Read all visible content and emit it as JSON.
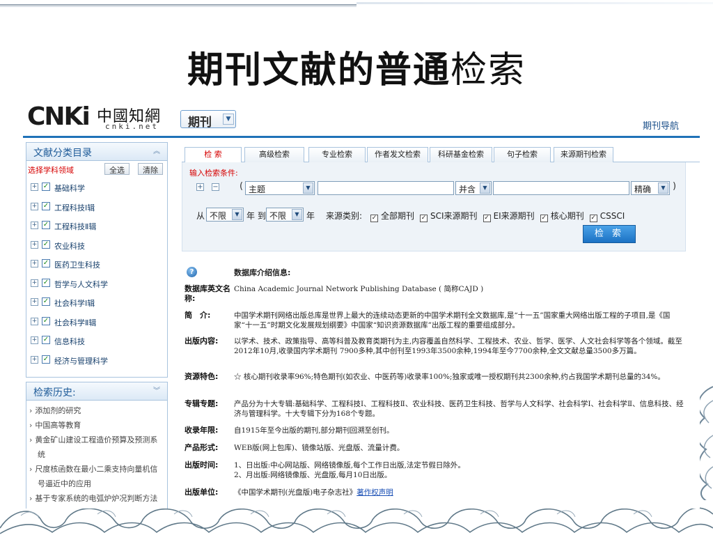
{
  "slide": {
    "title_bold": "期刊文献的普通",
    "title_normal": "检索"
  },
  "header": {
    "logo_cnki": "CNKi",
    "logo_cn": "中國知網",
    "logo_net": "cnki.net",
    "type_select": "期刊",
    "nav_link": "期刊导航"
  },
  "sidebar": {
    "title": "文献分类目录",
    "subject_label": "选择学科领域",
    "select_all": "全选",
    "clear": "清除",
    "items": [
      "基础科学",
      "工程科技Ⅰ辑",
      "工程科技Ⅱ辑",
      "农业科技",
      "医药卫生科技",
      "哲学与人文科学",
      "社会科学Ⅰ辑",
      "社会科学Ⅱ辑",
      "信息科技",
      "经济与管理科学"
    ]
  },
  "history": {
    "title": "检索历史:",
    "items": [
      [
        "添加剂的研究"
      ],
      [
        "中国高等教育"
      ],
      [
        "黄金矿山建设工程造价预算及预测系",
        "统"
      ],
      [
        "尺度核函数在最小二乘支持向量机信",
        "号逼近中的应用"
      ],
      [
        "基于专家系统的电弧炉炉况判断方法"
      ]
    ]
  },
  "tabs": [
    "检 索",
    "高级检索",
    "专业检索",
    "作者发文检索",
    "科研基金检索",
    "句子检索",
    "来源期刊检索"
  ],
  "search": {
    "condition_label": "输入检索条件:",
    "plus": "+",
    "minus": "−",
    "paren_open": "(",
    "paren_close": ")",
    "field": "主题",
    "term1": "",
    "relation": "并含",
    "term2": "",
    "match": "精确",
    "from_label": "从",
    "from_year": "不限",
    "year_to": "年 到",
    "to_year": "不限",
    "year": "年",
    "source_label": "来源类别:",
    "sources": [
      "全部期刊",
      "SCI来源期刊",
      "EI来源期刊",
      "核心期刊",
      "CSSCI"
    ],
    "search_button": "检 索"
  },
  "info": {
    "title": "数据库介绍信息:",
    "rows": [
      {
        "k": "数据库英文名称:",
        "v": "China Academic Journal Network Publishing Database ( 简称CAJD )"
      },
      {
        "k": "简　介:",
        "v": "中国学术期刊网络出版总库是世界上最大的连续动态更新的中国学术期刊全文数据库,是“十一五”国家重大网络出版工程的子项目,是《国家“十一五”时期文化发展规划纲要》中国家“知识资源数据库”出版工程的重要组成部分。"
      },
      {
        "k": "出版内容:",
        "v": "以学术、技术、政策指导、高等科普及教育类期刊为主,内容覆盖自然科学、工程技术、农业、哲学、医学、人文社会科学等各个领域。截至2012年10月,收录国内学术期刊 7900多种,其中创刊至1993年3500余种,1994年至今7700余种,全文文献总量3500多万篇。"
      },
      {
        "k": "资源特色:",
        "v": "☆ 核心期刊收录率96%;特色期刊(如农业、中医药等)收录率100%;独家或唯一授权期刊共2300余种,约占我国学术期刊总量的34%。"
      },
      {
        "k": "专辑专题:",
        "v": "产品分为十大专辑:基础科学、工程科技Ⅰ、工程科技Ⅱ、农业科技、医药卫生科技、哲学与人文科学、社会科学Ⅰ、社会科学Ⅱ、信息科技、经济与管理科学。十大专辑下分为168个专题。"
      },
      {
        "k": "收录年限:",
        "v": "自1915年至今出版的期刊,部分期刊回溯至创刊。"
      },
      {
        "k": "产品形式:",
        "v": "WEB版(网上包库)、镜像站版、光盘版、流量计费。"
      },
      {
        "k": "出版时间:",
        "v1": "1、日出版:中心网站版、网络镜像版,每个工作日出版,法定节假日除外。",
        "v2": "2、月出版:网络镜像版、光盘版,每月10日出版。"
      },
      {
        "k": "出版单位:",
        "v": "《中国学术期刊(光盘版)电子杂志社》",
        "link": "著作权声明"
      }
    ]
  },
  "colors": {
    "accent": "#1f72b8",
    "label_red": "#d60000",
    "link": "#1a4fb5"
  }
}
